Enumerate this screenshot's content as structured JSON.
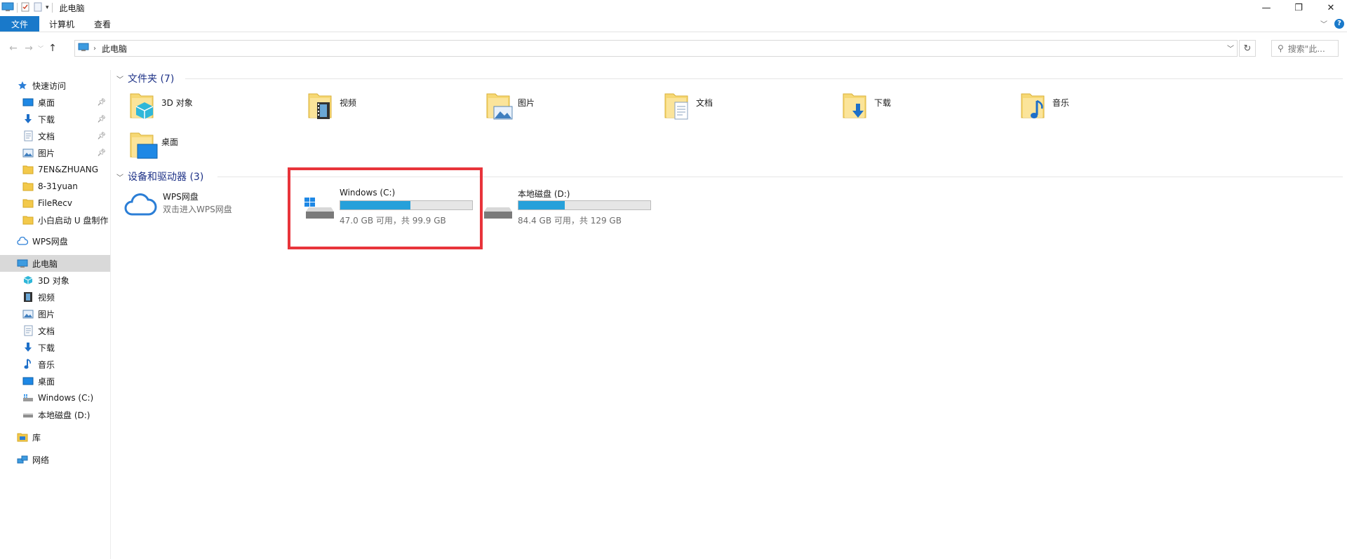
{
  "window": {
    "title": "此电脑"
  },
  "ribbon": {
    "tabs": [
      "文件",
      "计算机",
      "查看"
    ]
  },
  "address": {
    "path": "此电脑",
    "search_placeholder": "搜索\"此..."
  },
  "sidebar": {
    "quick_access": "快速访问",
    "quick_items": [
      {
        "label": "桌面",
        "icon": "desktop-icon",
        "pinned": true
      },
      {
        "label": "下载",
        "icon": "download-icon",
        "pinned": true
      },
      {
        "label": "文档",
        "icon": "document-icon",
        "pinned": true
      },
      {
        "label": "图片",
        "icon": "picture-icon",
        "pinned": true
      },
      {
        "label": "7EN&ZHUANG",
        "icon": "folder-icon",
        "pinned": false
      },
      {
        "label": "8-31yuan",
        "icon": "folder-icon",
        "pinned": false
      },
      {
        "label": "FileRecv",
        "icon": "folder-icon",
        "pinned": false
      },
      {
        "label": "小白启动 U 盘制作",
        "icon": "folder-icon",
        "pinned": false
      }
    ],
    "wps": "WPS网盘",
    "this_pc": "此电脑",
    "pc_items": [
      {
        "label": "3D 对象",
        "icon": "3d-objects-icon"
      },
      {
        "label": "视频",
        "icon": "video-icon"
      },
      {
        "label": "图片",
        "icon": "picture-icon"
      },
      {
        "label": "文档",
        "icon": "document-icon"
      },
      {
        "label": "下载",
        "icon": "download-icon"
      },
      {
        "label": "音乐",
        "icon": "music-icon"
      },
      {
        "label": "桌面",
        "icon": "desktop-icon"
      },
      {
        "label": "Windows (C:)",
        "icon": "windows-drive-icon"
      },
      {
        "label": "本地磁盘 (D:)",
        "icon": "drive-icon"
      }
    ],
    "library": "库",
    "network": "网络"
  },
  "folders_group": {
    "title": "文件夹 (7)"
  },
  "folders": [
    {
      "label": "3D 对象",
      "icon": "3d-objects-folder-icon"
    },
    {
      "label": "视频",
      "icon": "video-folder-icon"
    },
    {
      "label": "图片",
      "icon": "picture-folder-icon"
    },
    {
      "label": "文档",
      "icon": "document-folder-icon"
    },
    {
      "label": "下载",
      "icon": "download-folder-icon"
    },
    {
      "label": "音乐",
      "icon": "music-folder-icon"
    },
    {
      "label": "桌面",
      "icon": "desktop-folder-icon"
    }
  ],
  "devices_group": {
    "title": "设备和驱动器 (3)"
  },
  "wps_drive": {
    "name": "WPS网盘",
    "subtitle": "双击进入WPS网盘"
  },
  "drives": [
    {
      "name": "Windows (C:)",
      "free": "47.0 GB 可用，共 99.9 GB",
      "used_fraction": 0.53
    },
    {
      "name": "本地磁盘 (D:)",
      "free": "84.4 GB 可用，共 129 GB",
      "used_fraction": 0.35
    }
  ],
  "colors": {
    "accent": "#1979ca",
    "bar_fill": "#26a0da",
    "highlight": "#e8343b",
    "group_title": "#1e3287"
  }
}
